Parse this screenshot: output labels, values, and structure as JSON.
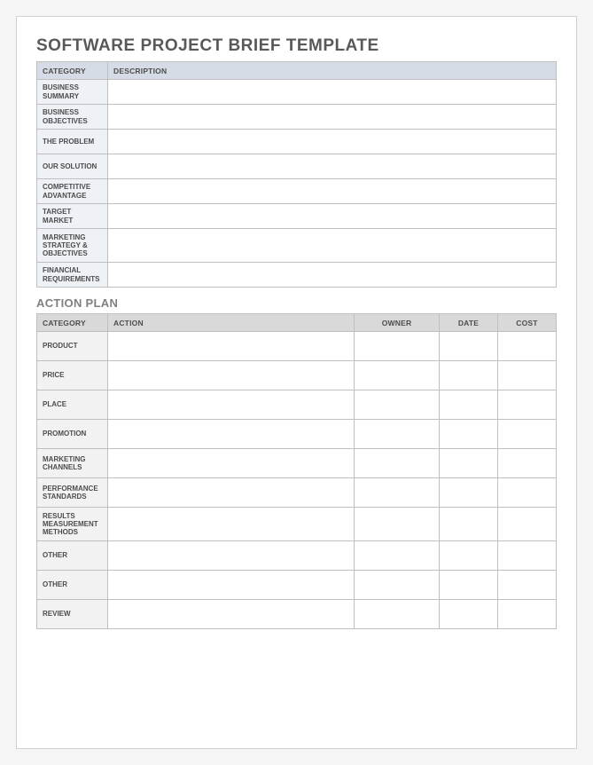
{
  "title": "SOFTWARE PROJECT BRIEF TEMPLATE",
  "table1": {
    "headers": {
      "category": "CATEGORY",
      "description": "DESCRIPTION"
    },
    "rows": [
      {
        "label": "BUSINESS SUMMARY",
        "value": ""
      },
      {
        "label": "BUSINESS OBJECTIVES",
        "value": ""
      },
      {
        "label": "THE PROBLEM",
        "value": ""
      },
      {
        "label": "OUR SOLUTION",
        "value": ""
      },
      {
        "label": "COMPETITIVE ADVANTAGE",
        "value": ""
      },
      {
        "label": "TARGET MARKET",
        "value": ""
      },
      {
        "label": "MARKETING STRATEGY & OBJECTIVES",
        "value": ""
      },
      {
        "label": "FINANCIAL REQUIREMENTS",
        "value": ""
      }
    ]
  },
  "subtitle": "ACTION PLAN",
  "table2": {
    "headers": {
      "category": "CATEGORY",
      "action": "ACTION",
      "owner": "OWNER",
      "date": "DATE",
      "cost": "COST"
    },
    "rows": [
      {
        "label": "PRODUCT",
        "action": "",
        "owner": "",
        "date": "",
        "cost": ""
      },
      {
        "label": "PRICE",
        "action": "",
        "owner": "",
        "date": "",
        "cost": ""
      },
      {
        "label": "PLACE",
        "action": "",
        "owner": "",
        "date": "",
        "cost": ""
      },
      {
        "label": "PROMOTION",
        "action": "",
        "owner": "",
        "date": "",
        "cost": ""
      },
      {
        "label": "MARKETING CHANNELS",
        "action": "",
        "owner": "",
        "date": "",
        "cost": ""
      },
      {
        "label": "PERFORMANCE STANDARDS",
        "action": "",
        "owner": "",
        "date": "",
        "cost": ""
      },
      {
        "label": "RESULTS MEASUREMENT METHODS",
        "action": "",
        "owner": "",
        "date": "",
        "cost": ""
      },
      {
        "label": "OTHER",
        "action": "",
        "owner": "",
        "date": "",
        "cost": ""
      },
      {
        "label": "OTHER",
        "action": "",
        "owner": "",
        "date": "",
        "cost": ""
      },
      {
        "label": "REVIEW",
        "action": "",
        "owner": "",
        "date": "",
        "cost": ""
      }
    ]
  }
}
